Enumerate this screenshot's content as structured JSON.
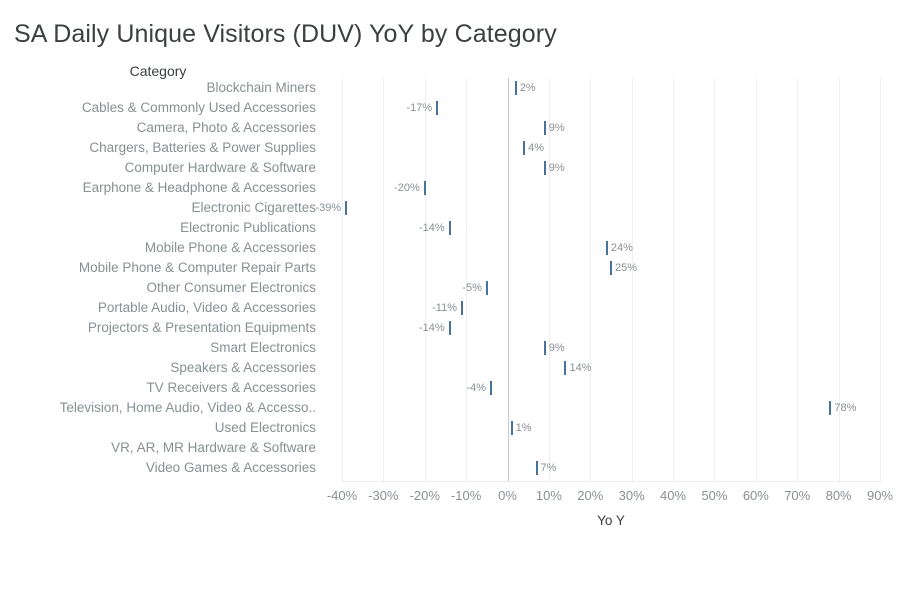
{
  "chart_data": {
    "type": "bar",
    "title": "SA Daily Unique Visitors (DUV) YoY by Category",
    "xlabel": "Yo Y",
    "ylabel": "Category",
    "grid": true,
    "legend": "none",
    "orientation": "horizontal",
    "xlim": [
      -40,
      90
    ],
    "xtick_step": 10,
    "xticks": [
      "-40%",
      "-30%",
      "-20%",
      "-10%",
      "0%",
      "10%",
      "20%",
      "30%",
      "40%",
      "50%",
      "60%",
      "70%",
      "80%",
      "90%"
    ],
    "xtick_values": [
      -40,
      -30,
      -20,
      -10,
      0,
      10,
      20,
      30,
      40,
      50,
      60,
      70,
      80,
      90
    ],
    "categories": [
      "Blockchain Miners",
      "Cables & Commonly Used Accessories",
      "Camera, Photo & Accessories",
      "Chargers, Batteries & Power Supplies",
      "Computer Hardware & Software",
      "Earphone & Headphone & Accessories",
      "Electronic Cigarettes",
      "Electronic Publications",
      "Mobile Phone & Accessories",
      "Mobile Phone & Computer Repair Parts",
      "Other Consumer Electronics",
      "Portable Audio, Video & Accessories",
      "Projectors & Presentation Equipments",
      "Smart Electronics",
      "Speakers & Accessories",
      "TV Receivers & Accessories",
      "Television, Home Audio, Video & Accesso..",
      "Used Electronics",
      "VR, AR, MR Hardware & Software",
      "Video Games & Accessories"
    ],
    "values": [
      2,
      -17,
      9,
      4,
      9,
      -20,
      -39,
      -14,
      24,
      25,
      -5,
      -11,
      -14,
      9,
      14,
      -4,
      78,
      1,
      null,
      7
    ],
    "value_labels": [
      "2%",
      "-17%",
      "9%",
      "4%",
      "9%",
      "-20%",
      "-39%",
      "-14%",
      "24%",
      "25%",
      "-5%",
      "-11%",
      "-14%",
      "9%",
      "14%",
      "-4%",
      "78%",
      "1%",
      "",
      "7%"
    ],
    "series_color": "#48729b",
    "gridline_color": "#f0f0f0",
    "zero_line_color": "#c8c8c8",
    "label_color": "#8a8f94",
    "title_color": "#3c4043"
  }
}
